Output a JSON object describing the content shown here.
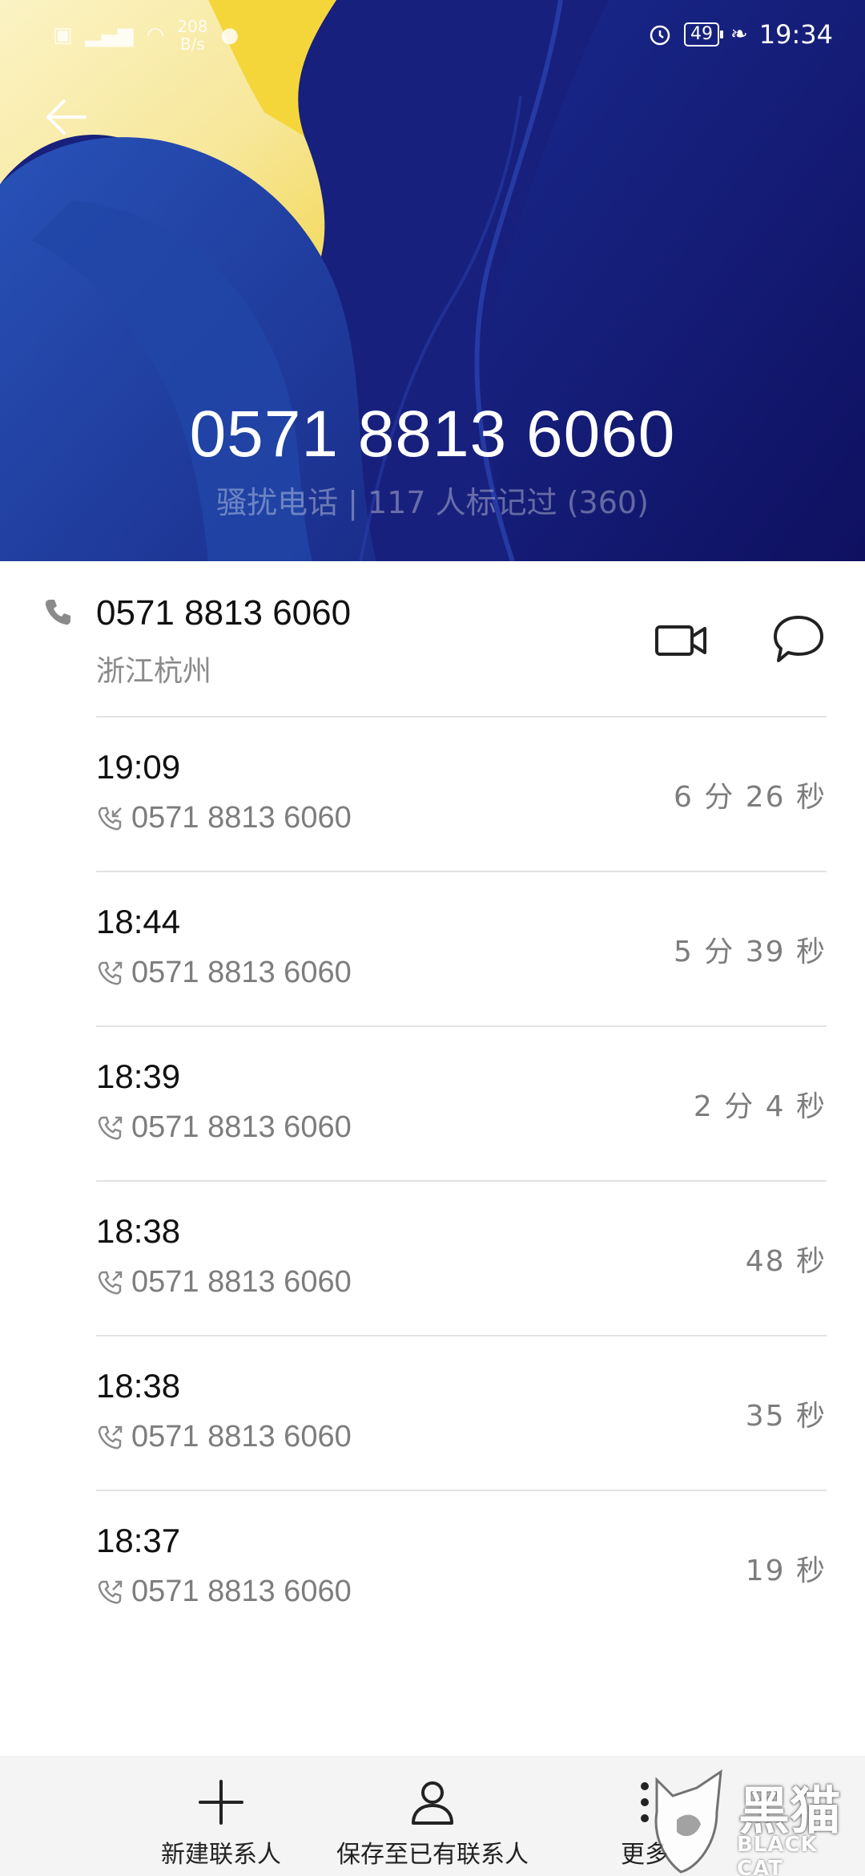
{
  "status_bar": {
    "network_speed": "208",
    "network_speed_unit": "B/s",
    "battery": "49",
    "time": "19:34"
  },
  "header": {
    "number": "0571 8813 6060",
    "tag": "骚扰电话 | 117 人标记过 (360)"
  },
  "contact": {
    "number": "0571 8813 6060",
    "location": "浙江杭州"
  },
  "calls": [
    {
      "time": "19:09",
      "number": "0571 8813 6060",
      "duration": "6 分 26 秒",
      "direction": "incoming"
    },
    {
      "time": "18:44",
      "number": "0571 8813 6060",
      "duration": "5 分 39 秒",
      "direction": "outgoing"
    },
    {
      "time": "18:39",
      "number": "0571 8813 6060",
      "duration": "2 分 4 秒",
      "direction": "outgoing"
    },
    {
      "time": "18:38",
      "number": "0571 8813 6060",
      "duration": "48 秒",
      "direction": "outgoing"
    },
    {
      "time": "18:38",
      "number": "0571 8813 6060",
      "duration": "35 秒",
      "direction": "outgoing"
    },
    {
      "time": "18:37",
      "number": "0571 8813 6060",
      "duration": "19 秒",
      "direction": "outgoing"
    }
  ],
  "bottom_bar": {
    "new_contact": "新建联系人",
    "save_existing": "保存至已有联系人",
    "more": "更多"
  },
  "watermark": {
    "text_cn": "黑猫",
    "text_en": "BLACK CAT"
  },
  "icons": {
    "back": "arrow-left-icon",
    "phone": "phone-icon",
    "video": "video-camera-icon",
    "message": "message-bubble-icon",
    "incoming": "incoming-call-icon",
    "outgoing": "outgoing-call-icon",
    "add": "plus-icon",
    "person": "person-icon",
    "more": "more-vertical-icon"
  },
  "colors": {
    "header_blue": "#1b2e86",
    "wallpaper_yellow": "#f7e9a0",
    "secondary_text": "#7d7d7d"
  }
}
